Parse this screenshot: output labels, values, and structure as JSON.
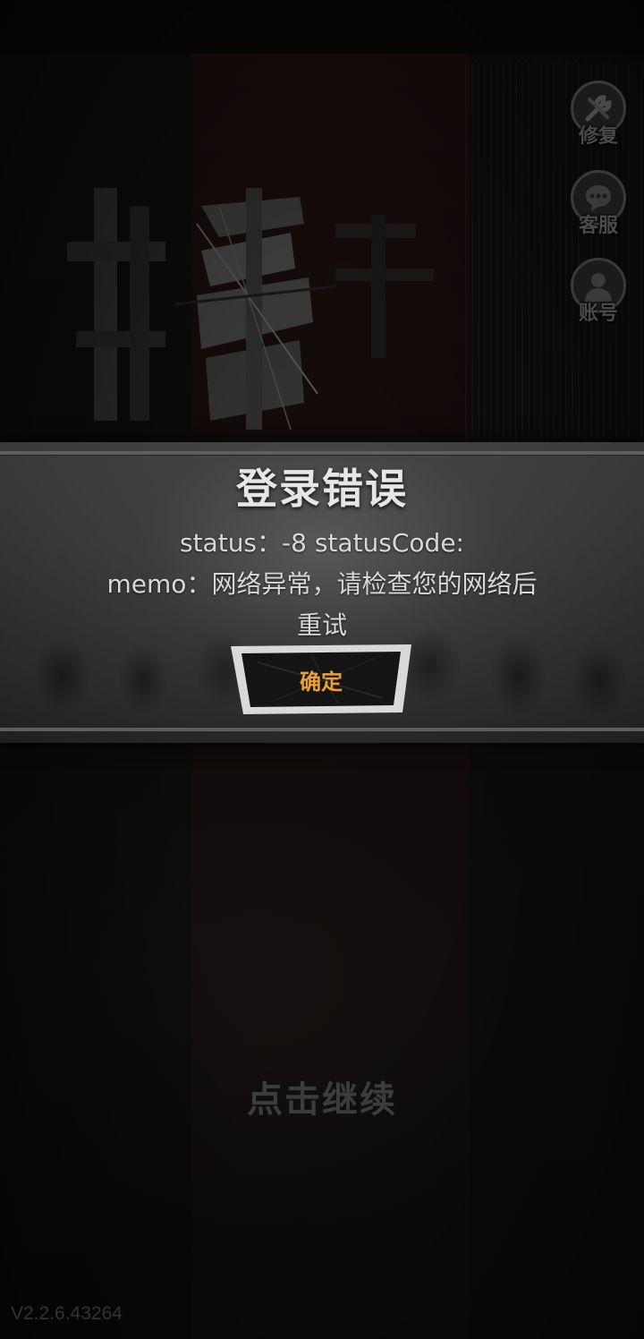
{
  "side_buttons": {
    "repair": {
      "label": "修复",
      "icon": "wrench-icon"
    },
    "service": {
      "label": "客服",
      "icon": "chat-bubble-icon"
    },
    "account": {
      "label": "账号",
      "icon": "user-icon"
    }
  },
  "dialog": {
    "title": "登录错误",
    "line1": "status：-8  statusCode:",
    "line2": "memo：网络异常，请检查您的网络后",
    "line3": "重试",
    "confirm_label": "确定"
  },
  "tap_to_continue": "点击继续",
  "version": "V2.2.6.43264",
  "colors": {
    "accent": "#e8a032",
    "dialog_text": "#d8d8d8",
    "side_label": "#4a4a4a"
  }
}
